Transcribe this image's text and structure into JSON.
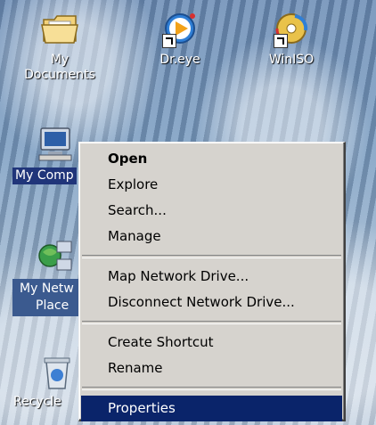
{
  "desktop_icons": {
    "my_documents": "My Documents",
    "dr_eye": "Dr.eye",
    "winiso": "WinISO",
    "my_computer": "My Comp",
    "network_line1": "My Netw",
    "network_line2": "Place",
    "recycle": "Recycle"
  },
  "context_menu": {
    "open": "Open",
    "explore": "Explore",
    "search": "Search...",
    "manage": "Manage",
    "map_drive": "Map Network Drive...",
    "disconnect_drive": "Disconnect Network Drive...",
    "create_shortcut": "Create Shortcut",
    "rename": "Rename",
    "properties": "Properties"
  },
  "colors": {
    "selection": "#0a246a",
    "menu_bg": "#d6d3ce",
    "label_selected": "#20357a"
  },
  "icons": [
    "folder-icon",
    "dr-eye-icon",
    "winiso-icon",
    "computer-icon",
    "network-icon",
    "recycle-bin-icon"
  ]
}
